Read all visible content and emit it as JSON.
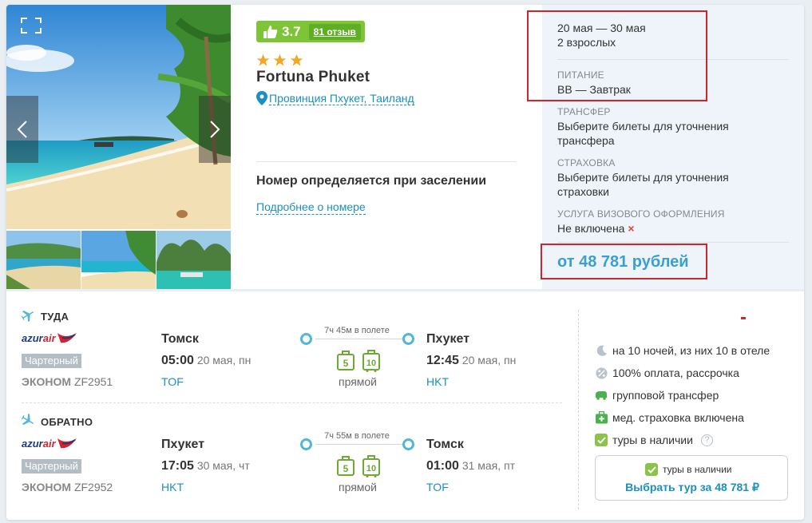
{
  "hotel": {
    "rating": "3.7",
    "reviews": "81 отзыв",
    "stars": 3,
    "name": "Fortuna Phuket",
    "location": "Провинция Пхукет, Таиланд",
    "room_title": "Номер определяется при заселении",
    "room_link": "Подробнее о номере"
  },
  "summary": {
    "dates": "20 мая — 30 мая",
    "guests": "2 взрослых",
    "meal_label": "ПИТАНИЕ",
    "meal_value": "BB — Завтрак",
    "transfer_label": "ТРАНСФЕР",
    "transfer_value_1": "Выберите билеты для уточнения",
    "transfer_value_2": "трансфера",
    "insurance_label": "СТРАХОВКА",
    "insurance_value_1": "Выберите билеты для уточнения",
    "insurance_value_2": "страховки",
    "visa_label": "УСЛУГА ВИЗОВОГО ОФОРМЛЕНИЯ",
    "visa_value": "Не включена",
    "visa_mark": "×",
    "price": "от 48 781 рублей"
  },
  "flights": [
    {
      "direction": "ТУДА",
      "airline_a": "azur",
      "airline_b": "air",
      "charter": "Чартерный",
      "class": "ЭКОНОМ",
      "flight_no": "ZF2951",
      "from_city": "Томск",
      "dep_time": "05:00",
      "dep_date": "20 мая, пн",
      "from_code": "TOF",
      "duration": "7ч 45м в полете",
      "bag_1": "5",
      "bag_2": "10",
      "stops": "прямой",
      "to_city": "Пхукет",
      "arr_time": "12:45",
      "arr_date": "20 мая, пн",
      "to_code": "HKT"
    },
    {
      "direction": "ОБРАТНО",
      "airline_a": "azur",
      "airline_b": "air",
      "charter": "Чартерный",
      "class": "ЭКОНОМ",
      "flight_no": "ZF2952",
      "from_city": "Пхукет",
      "dep_time": "17:05",
      "dep_date": "30 мая, чт",
      "from_code": "HKT",
      "duration": "7ч 55м в полете",
      "bag_1": "5",
      "bag_2": "10",
      "stops": "прямой",
      "to_city": "Томск",
      "arr_time": "01:00",
      "arr_date": "31 мая, пт",
      "to_code": "TOF"
    }
  ],
  "features": {
    "nights": "на 10 ночей, из них 10 в отеле",
    "payment": "100% оплата, рассрочка",
    "transfer": "групповой трансфер",
    "insurance": "мед. страховка включена",
    "availability": "туры в наличии",
    "help": "?"
  },
  "cta": {
    "availability": "туры в наличии",
    "button": "Выбрать тур за 48 781 ₽"
  },
  "colors": {
    "accent": "#1b8fc0",
    "rating_green": "#7dc537",
    "star": "#f5a623",
    "highlight": "#d1242d"
  }
}
